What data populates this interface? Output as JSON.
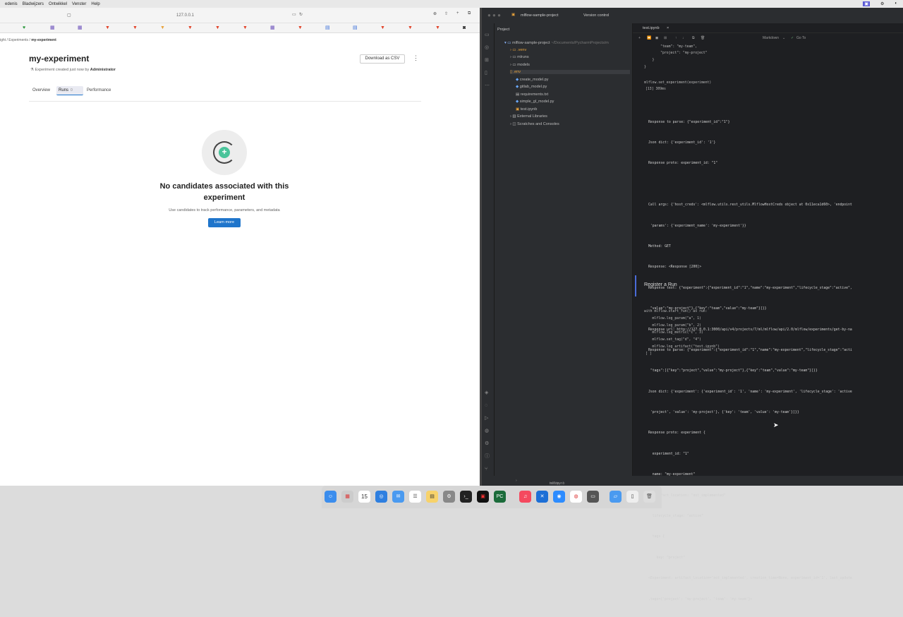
{
  "menubar": {
    "items": [
      "edenis",
      "Bladwijzers",
      "Ontwikkel",
      "Venster",
      "Help"
    ]
  },
  "browser": {
    "url": "127.0.0.1",
    "breadcrumb": {
      "prefix": "ight",
      "sep": "/",
      "experiments": "Experiments",
      "current": "my-experiment"
    },
    "title": "my-experiment",
    "subtitle_prefix": "Experiment created just now by",
    "subtitle_author": "Administrator",
    "download_csv": "Download as CSV",
    "tabs": [
      {
        "label": "Overview"
      },
      {
        "label": "Runs",
        "count": "0"
      },
      {
        "label": "Performance"
      }
    ],
    "empty": {
      "title": "No candidates associated with this experiment",
      "description": "Use candidates to track performance, parameters, and metadata",
      "button": "Learn more"
    }
  },
  "ide": {
    "project_name": "mlflow-sample-project",
    "version_control": "Version control",
    "panel_title": "Project",
    "tree": [
      {
        "label": "mlflow-sample-project",
        "path": "~/Documents/PycharmProjects/m"
      },
      {
        "label": ".venv"
      },
      {
        "label": "mlruns"
      },
      {
        "label": "models"
      },
      {
        "label": ".env"
      },
      {
        "label": "create_model.py"
      },
      {
        "label": "gitlab_model.py"
      },
      {
        "label": "requirements.txt"
      },
      {
        "label": "simple_gl_model.py"
      },
      {
        "label": "test.ipynb"
      },
      {
        "label": "External Libraries"
      },
      {
        "label": "Scratches and Consoles"
      }
    ],
    "editor_tab": "test.ipynb",
    "toolbar_mode": "Markdown",
    "toolbar_goto": "Go To",
    "code_top": [
      "        \"team\": \"my-team\",",
      "        \"project\": \"my-project\"",
      "    }",
      "}"
    ],
    "set_experiment": "mlflow.set_experiment(experiment)",
    "exec_info": "[13] 309ms",
    "output_lines": [
      "Response to parse: {\"experiment_id\":\"1\"}",
      "Json dict: {'experiment_id': '1'}",
      "Response proto: experiment_id: \"1\"",
      "",
      "Call args: {'host_creds': <mlflow.utils.rest_utils.MlflowHostCreds object at 0x11eca1d60>, 'endpoint",
      " 'params': {'experiment_name': 'my-experiment'}}",
      "Method: GET",
      "Response: <Response [200]>",
      "Response text: {\"experiment\":{\"experiment_id\":\"1\",\"name\":\"my-experiment\",\"lifecycle_stage\":\"active\",",
      " \"value\":\"my-project\"},{\"key\":\"team\",\"value\":\"my-team\"}]}}",
      "Response url: http://127.0.0.1:3000/api/v4/projects/7/ml/mlflow/api/2.0/mlflow/experiments/get-by-na",
      "Response to parse: {\"experiment\":{\"experiment_id\":\"1\",\"name\":\"my-experiment\",\"lifecycle_stage\":\"acti",
      " \"tags\":[{\"key\":\"project\",\"value\":\"my-project\"},{\"key\":\"team\",\"value\":\"my-team\"}]}}",
      "Json dict: {'experiment': {'experiment_id': '1', 'name': 'my-experiment', 'lifecycle_stage': 'active",
      " 'project', 'value': 'my-project'}, {'key': 'team', 'value': 'my-team'}]}}",
      "Response proto: experiment {",
      "  experiment_id: \"1\"",
      "  name: \"my-experiment\"",
      "  artifact_location: \"not_implemented\"",
      "  lifecycle_stage: \"active\"",
      "  tags {",
      "    key: \"project\"",
      "<Experiment: artifact_location='not_implemented', creation_time=None, experiment_id='1', last_update",
      ",tags={'project': 'my-project', 'team': 'my-team'}>"
    ],
    "markdown_cell": "Register a Run",
    "run_code": [
      "with mlflow.start_run() as run:",
      "    mlflow.log_param(\"a\", 1)",
      "    mlflow.log_param(\"b\", 2)",
      "    mlflow.log_metric(\"c\", 3)",
      "    mlflow.set_tag(\"d\", \"4\")",
      "    mlflow.log_artifact(\"test.ipynb\")"
    ],
    "run_exec": "[ ]",
    "status_path": "mlflow-sample-project",
    "status_file": "test.ipynb"
  },
  "dock": {
    "calendar_day": "15"
  },
  "colors": {
    "primary": "#1f75cb",
    "empty_accent": "#49c49a",
    "ide_bg": "#1e1f22"
  }
}
